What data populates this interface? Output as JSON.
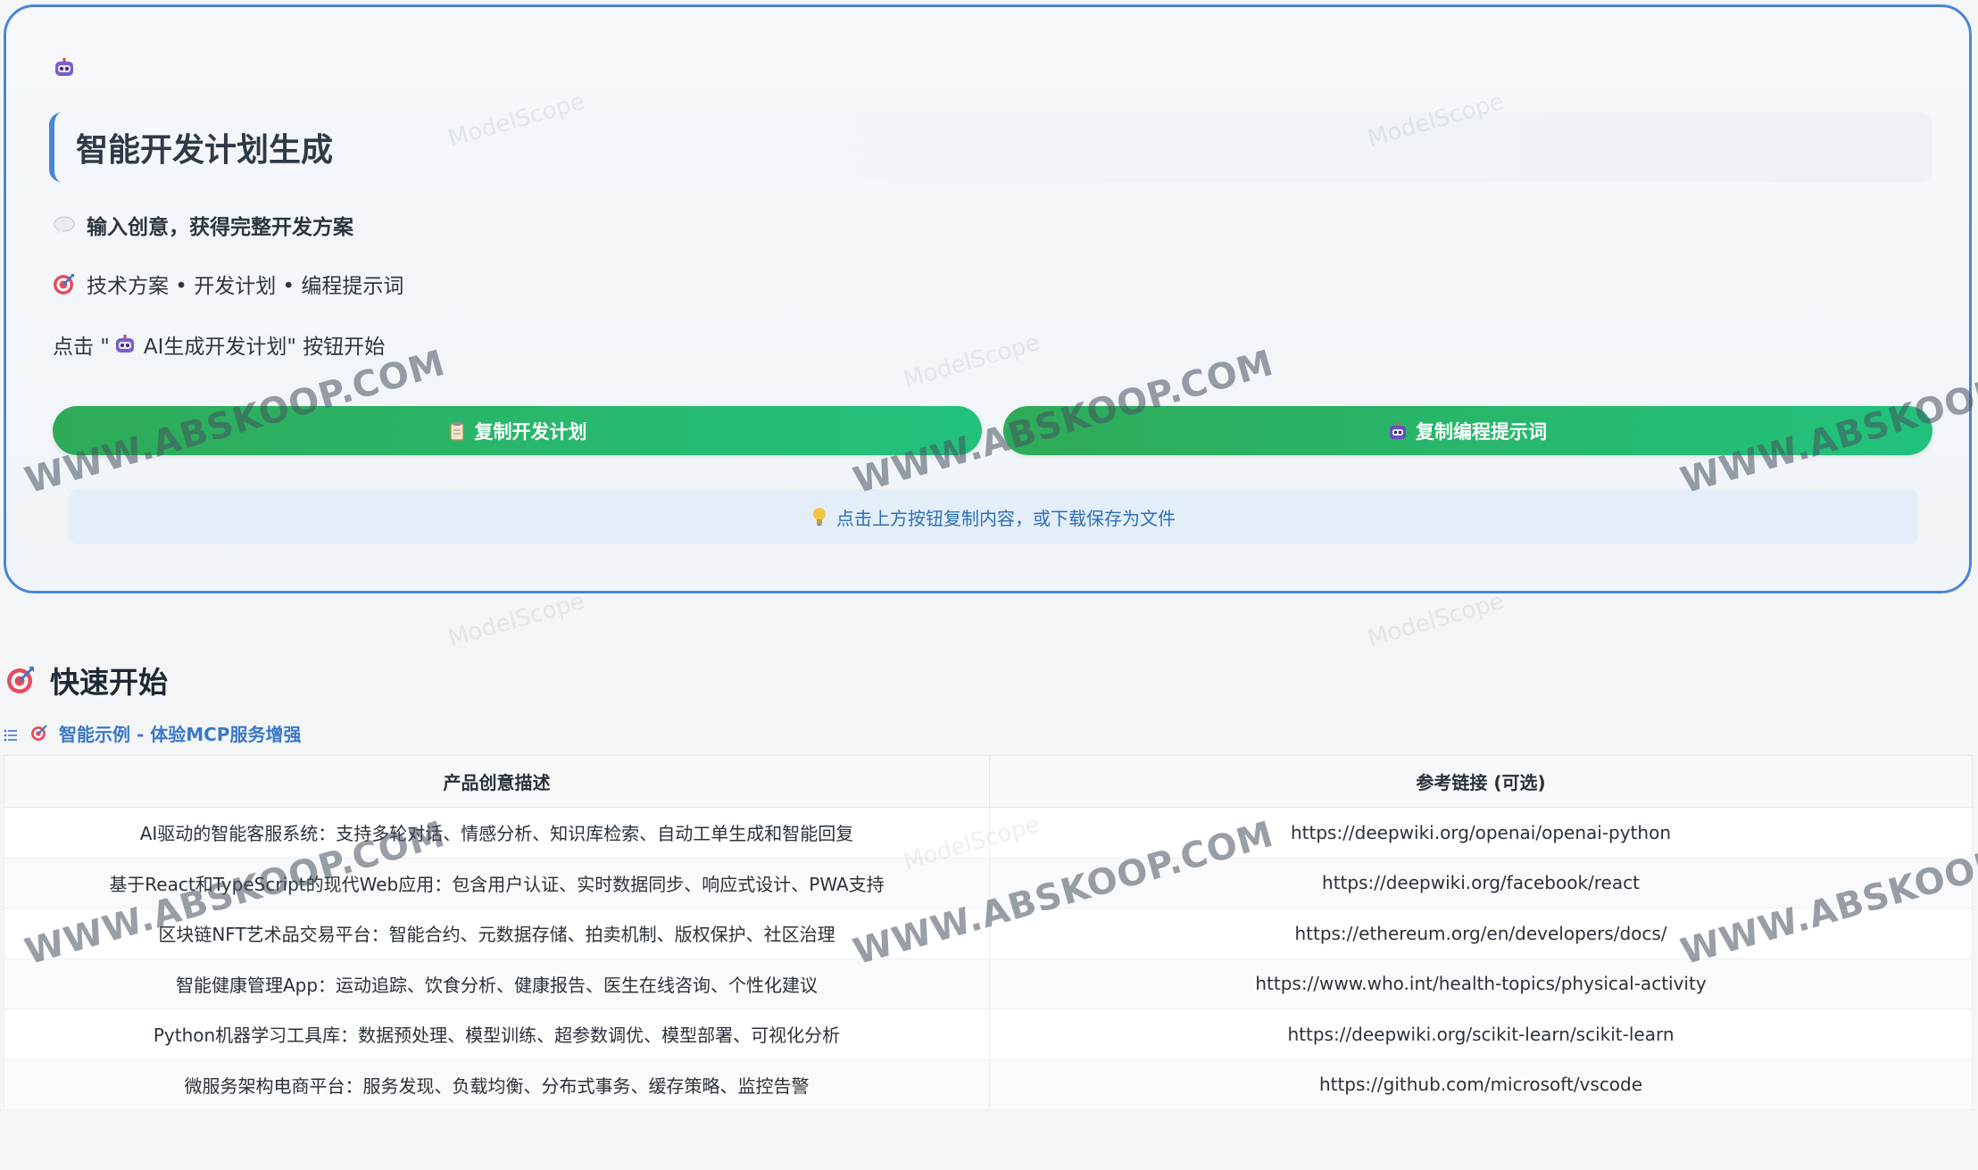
{
  "panel": {
    "title": "智能开发计划生成",
    "line1": "输入创意，获得完整开发方案",
    "line2": "技术方案 • 开发计划 • 编程提示词",
    "line3_prefix": "点击 \"",
    "line3_button": "AI生成开发计划",
    "line3_suffix": "\" 按钮开始",
    "copy_plan_label": "复制开发计划",
    "copy_prompt_label": "复制编程提示词",
    "hint": "点击上方按钮复制内容，或下载保存为文件"
  },
  "quickstart": {
    "title": "快速开始",
    "examples_label": "智能示例 - 体验MCP服务增强",
    "headers": [
      "产品创意描述",
      "参考链接 (可选)"
    ],
    "rows": [
      [
        "AI驱动的智能客服系统：支持多轮对话、情感分析、知识库检索、自动工单生成和智能回复",
        "https://deepwiki.org/openai/openai-python"
      ],
      [
        "基于React和TypeScript的现代Web应用：包含用户认证、实时数据同步、响应式设计、PWA支持",
        "https://deepwiki.org/facebook/react"
      ],
      [
        "区块链NFT艺术品交易平台：智能合约、元数据存储、拍卖机制、版权保护、社区治理",
        "https://ethereum.org/en/developers/docs/"
      ],
      [
        "智能健康管理App：运动追踪、饮食分析、健康报告、医生在线咨询、个性化建议",
        "https://www.who.int/health-topics/physical-activity"
      ],
      [
        "Python机器学习工具库：数据预处理、模型训练、超参数调优、模型部署、可视化分析",
        "https://deepwiki.org/scikit-learn/scikit-learn"
      ],
      [
        "微服务架构电商平台：服务发现、负载均衡、分布式事务、缓存策略、监控告警",
        "https://github.com/microsoft/vscode"
      ]
    ]
  },
  "watermark": {
    "text": "WWW.ABSKOOP.COM",
    "faint_text": "ModelScope"
  },
  "icons": {
    "robot": "robot-icon",
    "speech": "speech-bubble-icon",
    "target": "target-icon",
    "clipboard": "clipboard-icon",
    "bulb": "light-bulb-icon",
    "list": "list-icon"
  },
  "colors": {
    "accent": "#4a86d6",
    "button_start": "#2eab58",
    "button_end": "#22c27d",
    "hint_bg": "#e3eef9",
    "link": "#3a78c9"
  }
}
